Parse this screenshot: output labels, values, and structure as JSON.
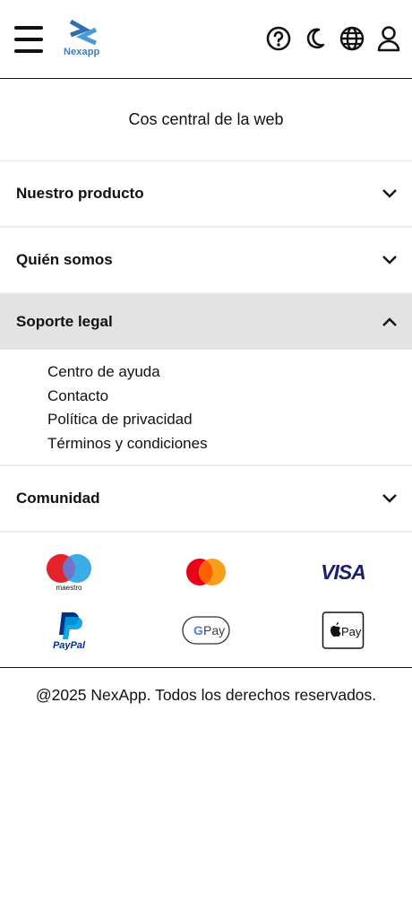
{
  "header": {
    "logo_text": "Nexapp",
    "brand_color": "#3a7cc0",
    "icons": [
      "menu-icon",
      "help-icon",
      "dark-mode-icon",
      "language-icon",
      "user-icon"
    ]
  },
  "tagline": "Cos central de la web",
  "accordion": [
    {
      "title": "Nuestro producto",
      "expanded": false
    },
    {
      "title": "Quién somos",
      "expanded": false
    },
    {
      "title": "Soporte legal",
      "expanded": true,
      "links": [
        "Centro de ayuda",
        "Contacto",
        "Política de privacidad",
        "Términos y condiciones"
      ]
    },
    {
      "title": "Comunidad",
      "expanded": false
    }
  ],
  "payments": {
    "maestro": "maestro",
    "visa": "VISA",
    "paypal": "PayPal",
    "gpay": "Pay",
    "applepay": "Pay"
  },
  "footer": {
    "copyright": "@2025 NexApp. Todos los derechos reservados."
  }
}
